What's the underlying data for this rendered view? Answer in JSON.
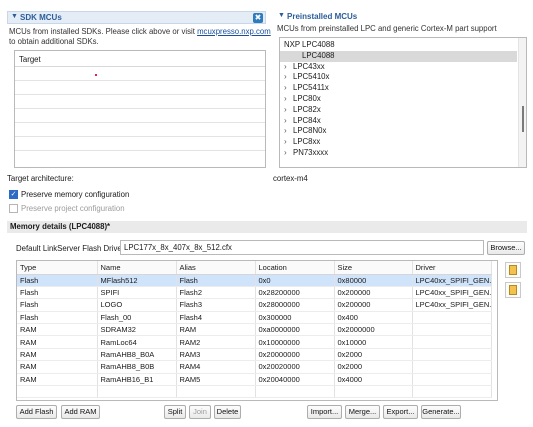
{
  "sdk": {
    "title": "SDK MCUs",
    "desc1": "MCUs from installed SDKs. Please click above or visit ",
    "link": "mcuxpresso.nxp.com",
    "desc2": "to obtain additional SDKs.",
    "column_header": "Target"
  },
  "preinstalled": {
    "title": "Preinstalled MCUs",
    "desc": "MCUs from preinstalled LPC and generic Cortex-M part support",
    "tree": [
      {
        "label": "NXP LPC4088",
        "level": 0,
        "expandable": false,
        "selected": false
      },
      {
        "label": "LPC4088",
        "level": 1,
        "expandable": false,
        "selected": true
      },
      {
        "label": "LPC43xx",
        "level": 0,
        "expandable": true,
        "selected": false
      },
      {
        "label": "LPC5410x",
        "level": 0,
        "expandable": true,
        "selected": false
      },
      {
        "label": "LPC5411x",
        "level": 0,
        "expandable": true,
        "selected": false
      },
      {
        "label": "LPC80x",
        "level": 0,
        "expandable": true,
        "selected": false
      },
      {
        "label": "LPC82x",
        "level": 0,
        "expandable": true,
        "selected": false
      },
      {
        "label": "LPC84x",
        "level": 0,
        "expandable": true,
        "selected": false
      },
      {
        "label": "LPC8N0x",
        "level": 0,
        "expandable": true,
        "selected": false
      },
      {
        "label": "LPC8xx",
        "level": 0,
        "expandable": true,
        "selected": false
      },
      {
        "label": "PN73xxxx",
        "level": 0,
        "expandable": true,
        "selected": false
      }
    ]
  },
  "target_arch": {
    "label": "Target architecture:",
    "value": "cortex-m4"
  },
  "options": {
    "preserve_memory": {
      "label": "Preserve memory configuration",
      "checked": true
    },
    "preserve_project": {
      "label": "Preserve project configuration",
      "checked": false
    }
  },
  "memory": {
    "title": "Memory details (LPC4088)*",
    "driver_label": "Default LinkServer Flash Driver",
    "driver_value": "LPC177x_8x_407x_8x_512.cfx",
    "browse_label": "Browse...",
    "columns": [
      "Type",
      "Name",
      "Alias",
      "Location",
      "Size",
      "Driver"
    ],
    "rows": [
      [
        "Flash",
        "MFlash512",
        "Flash",
        "0x0",
        "0x80000",
        "LPC40xx_SPIFI_GEN..."
      ],
      [
        "Flash",
        "SPIFI",
        "Flash2",
        "0x28200000",
        "0x200000",
        "LPC40xx_SPIFI_GEN..."
      ],
      [
        "Flash",
        "LOGO",
        "Flash3",
        "0x28000000",
        "0x200000",
        "LPC40xx_SPIFI_GEN..."
      ],
      [
        "Flash",
        "Flash_00",
        "Flash4",
        "0x300000",
        "0x400",
        ""
      ],
      [
        "RAM",
        "SDRAM32",
        "RAM",
        "0xa0000000",
        "0x2000000",
        ""
      ],
      [
        "RAM",
        "RamLoc64",
        "RAM2",
        "0x10000000",
        "0x10000",
        ""
      ],
      [
        "RAM",
        "RamAHB8_B0A",
        "RAM3",
        "0x20000000",
        "0x2000",
        ""
      ],
      [
        "RAM",
        "RamAHB8_B0B",
        "RAM4",
        "0x20020000",
        "0x2000",
        ""
      ],
      [
        "RAM",
        "RamAHB16_B1",
        "RAM5",
        "0x20040000",
        "0x4000",
        ""
      ]
    ],
    "selected_row": 0,
    "buttons": {
      "add_flash": "Add Flash",
      "add_ram": "Add RAM",
      "split": "Split",
      "join": "Join",
      "delete": "Delete",
      "import": "Import...",
      "merge": "Merge...",
      "export": "Export...",
      "generate": "Generate..."
    }
  },
  "colors": {
    "accent": "#2a5d9a",
    "selection": "#cfe3fb",
    "checkbox": "#2d6cc4"
  }
}
